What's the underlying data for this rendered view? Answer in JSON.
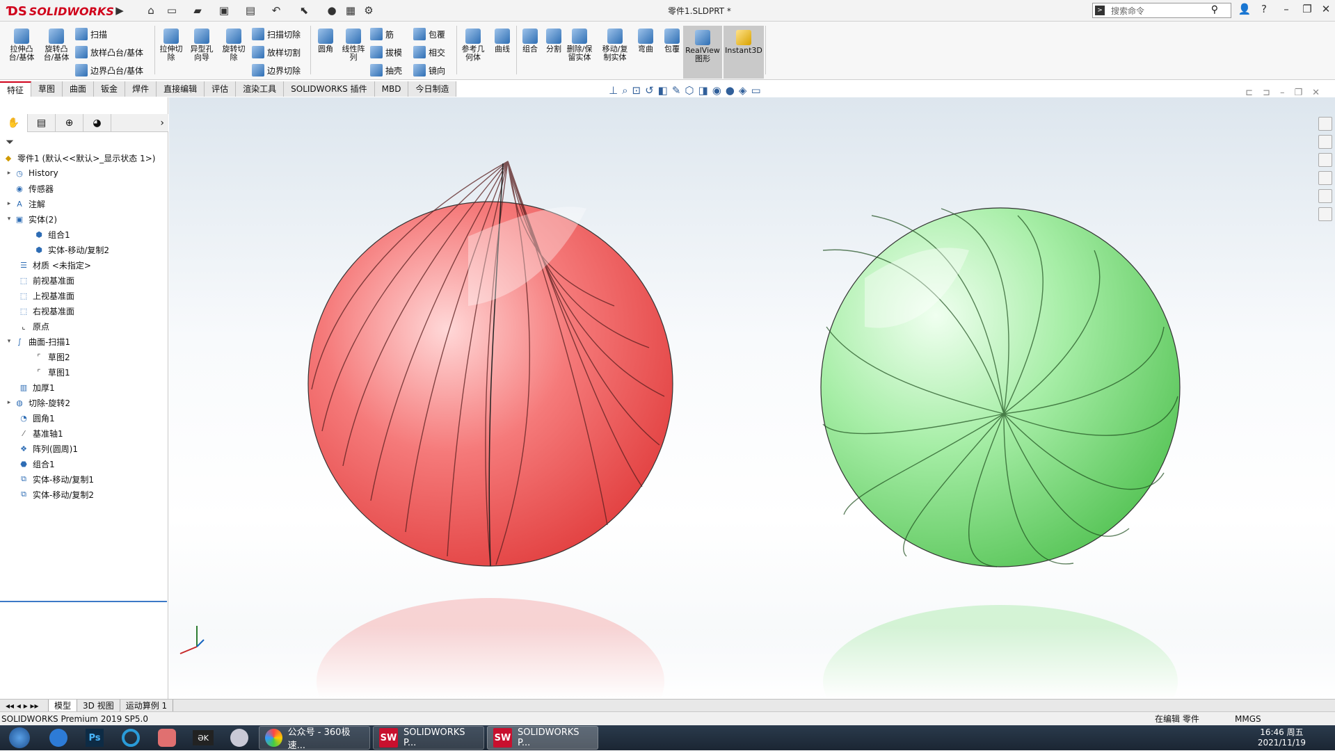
{
  "app": {
    "name": "SOLIDWORKS",
    "doc_title": "零件1.SLDPRT *",
    "search_placeholder": "搜索命令"
  },
  "ribbon": {
    "extrude_boss": "拉伸凸台/基体",
    "revolve_boss": "旋转凸台/基体",
    "sweep": "扫描",
    "loft_boss": "放样凸台/基体",
    "boundary_boss": "边界凸台/基体",
    "extrude_cut": "拉伸切除",
    "hole_wizard": "异型孔向导",
    "revolve_cut": "旋转切除",
    "sweep_cut": "扫描切除",
    "loft_cut": "放样切割",
    "boundary_cut": "边界切除",
    "fillet": "圆角",
    "linear_pattern": "线性阵列",
    "rib": "筋",
    "draft": "拔模",
    "shell": "抽壳",
    "wrap": "包覆",
    "intersect": "相交",
    "mirror": "镜向",
    "ref_geometry": "参考几何体",
    "curves": "曲线",
    "combine": "组合",
    "split": "分割",
    "delete_keep": "删除/保留实体",
    "move_copy": "移动/复制实体",
    "flex": "弯曲",
    "wrap2": "包覆",
    "realview": "RealView图形",
    "instant3d": "Instant3D"
  },
  "tabs": [
    "特征",
    "草图",
    "曲面",
    "钣金",
    "焊件",
    "直接编辑",
    "评估",
    "渲染工具",
    "SOLIDWORKS 插件",
    "MBD",
    "今日制造"
  ],
  "tree": {
    "root": "零件1 (默认<<默认>_显示状态 1>)",
    "items": [
      "History",
      "传感器",
      "注解",
      "实体(2)",
      "组合1",
      "实体-移动/复制2",
      "材质 <未指定>",
      "前视基准面",
      "上视基准面",
      "右视基准面",
      "原点",
      "曲面-扫描1",
      "草图2",
      "草图1",
      "加厚1",
      "切除-旋转2",
      "圆角1",
      "基准轴1",
      "阵列(圆周)1",
      "组合1",
      "实体-移动/复制1",
      "实体-移动/复制2"
    ]
  },
  "bottom_tabs": [
    "模型",
    "3D 视图",
    "运动算例 1"
  ],
  "status": {
    "left": "SOLIDWORKS Premium 2019 SP5.0",
    "editing": "在编辑 零件",
    "units": "MMGS"
  },
  "taskbar": {
    "window1": "公众号 - 360极速...",
    "window2": "SOLIDWORKS P...",
    "window3": "SOLIDWORKS P...",
    "time": "16:46 周五",
    "date": "2021/11/19"
  },
  "colors": {
    "red_sphere": "#f25555",
    "green_sphere": "#8be38b",
    "brand": "#d0021b"
  }
}
